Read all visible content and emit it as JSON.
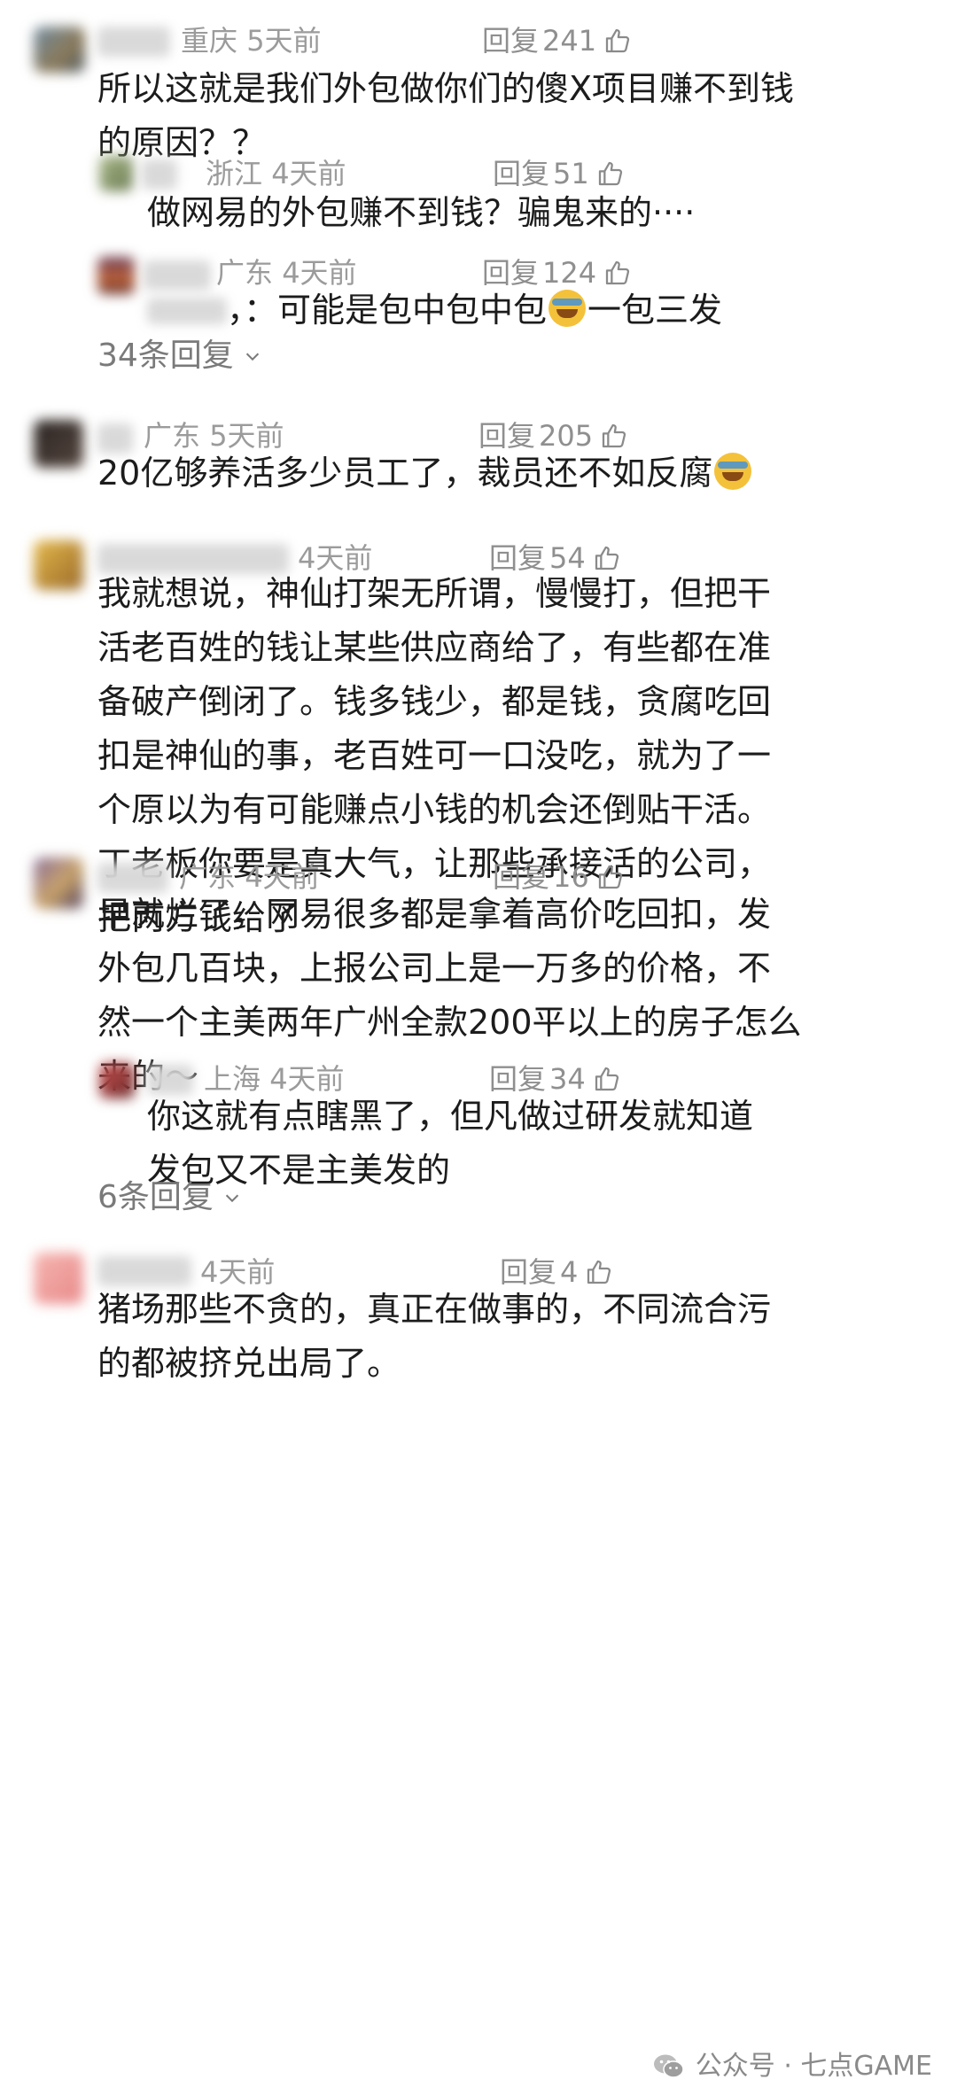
{
  "comments": [
    {
      "location": "重庆",
      "time": "5天前",
      "reply_label": "回复",
      "likes": "241",
      "body": "所以这就是我们外包做你们的傻X项目赚不到钱\n的原因？？",
      "avatar_color": "#5b6f7e",
      "replies": [
        {
          "location": "浙江",
          "time": "4天前",
          "reply_label": "回复",
          "likes": "51",
          "body": "做网易的外包赚不到钱？骗鬼来的····",
          "avatar_color": "#8fa070"
        },
        {
          "location": "广东",
          "time": "4天前",
          "reply_label": "回复",
          "likes": "124",
          "body_prefix": "，：可能是包中包中包",
          "body_suffix": "一包三发",
          "avatar_color": "#a0583c"
        }
      ],
      "more_replies": "34条回复"
    },
    {
      "location": "广东",
      "time": "5天前",
      "reply_label": "回复",
      "likes": "205",
      "body_prefix": "20亿够养活多少员工了，裁员还不如反腐",
      "avatar_color": "#3a3432"
    },
    {
      "time": "4天前",
      "reply_label": "回复",
      "likes": "54",
      "body": "我就想说，神仙打架无所谓，慢慢打，但把干\n活老百姓的钱让某些供应商给了，有些都在准\n备破产倒闭了。钱多钱少，都是钱，贪腐吃回\n扣是神仙的事，老百姓可一口没吃，就为了一\n个原以为有可能赚点小钱的机会还倒贴干活。\n丁老板你要是真大气，让那些承接活的公司，\n把丙方钱给了",
      "avatar_color": "#c89a3a"
    },
    {
      "location": "广东",
      "time": "4天前",
      "reply_label": "回复",
      "likes": "16",
      "body": "早就烂了，网易很多都是拿着高价吃回扣，发\n外包几百块，上报公司上是一万多的价格，不\n然一个主美两年广州全款200平以上的房子怎么\n来的～",
      "avatar_color": "#7c6a8a",
      "replies": [
        {
          "location": "上海",
          "time": "4天前",
          "reply_label": "回复",
          "likes": "34",
          "body": "你这就有点瞎黑了，但凡做过研发就知道\n发包又不是主美发的",
          "avatar_color": "#b24a4a"
        }
      ],
      "more_replies": "6条回复"
    },
    {
      "time": "4天前",
      "reply_label": "回复",
      "likes": "4",
      "body": "猪场那些不贪的，真正在做事的，不同流合污\n的都被挤兑出局了。",
      "avatar_color": "#f0a8a8"
    }
  ],
  "watermark": {
    "text": "公众号 · 七点GAME",
    "icon": "wechat-icon"
  },
  "colors": {
    "meta": "#9b9b9b",
    "text": "#1c1c1c",
    "background": "#ffffff"
  }
}
